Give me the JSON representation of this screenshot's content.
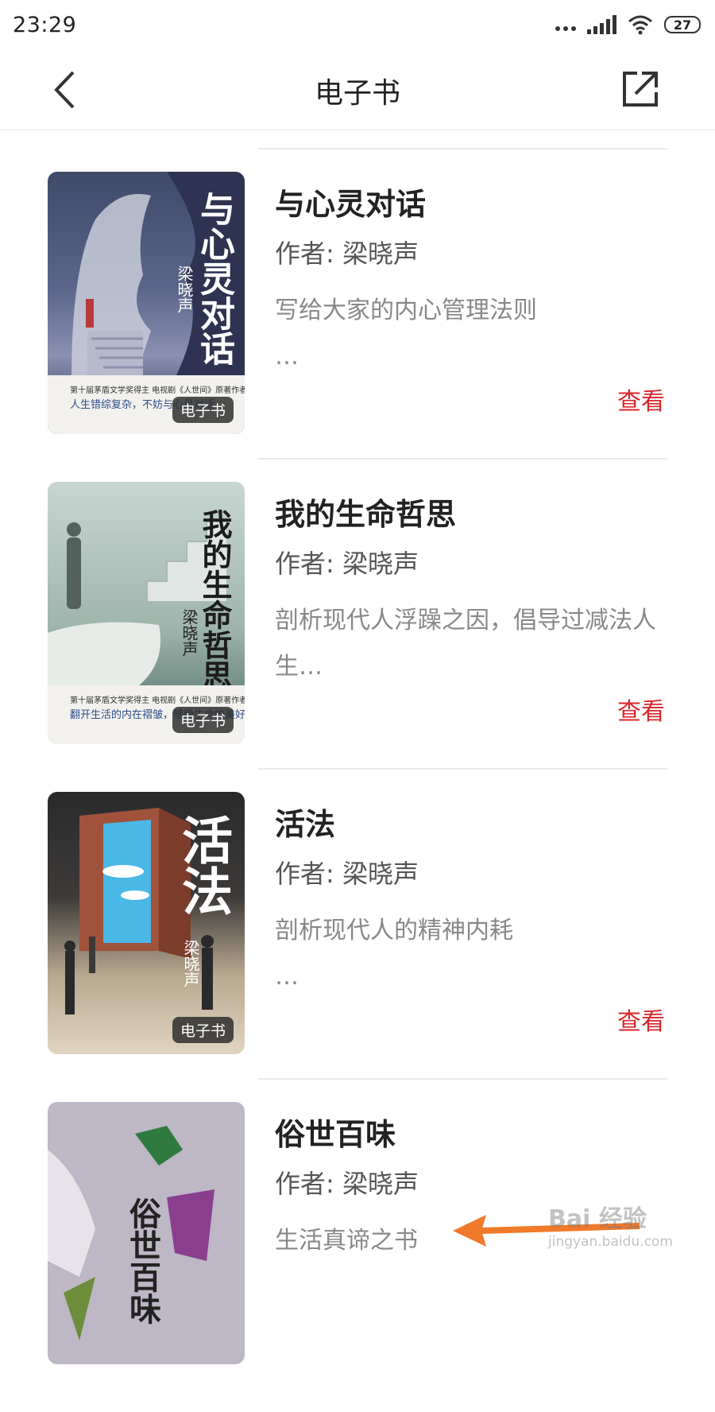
{
  "status_bar": {
    "time": "23:29",
    "battery": "27"
  },
  "header": {
    "title": "电子书"
  },
  "books": [
    {
      "title": "与心灵对话",
      "author": "作者: 梁晓声",
      "description": "写给大家的内心管理法则\n…",
      "action": "查看",
      "badge": "电子书",
      "cover_title": "与心灵对话",
      "cover_author": "梁晓声",
      "cover_line1": "第十届茅盾文学奖得主   电视剧《人世间》原著作者  梁晓声",
      "cover_line2": "人生错综复杂，不妨与心灵对话"
    },
    {
      "title": "我的生命哲思",
      "author": "作者: 梁晓声",
      "description": "剖析现代人浮躁之因，倡导过减法人生…",
      "action": "查看",
      "badge": "电子书",
      "cover_title": "我的生命哲思",
      "cover_author": "梁晓声",
      "cover_line1": "第十届茅盾文学奖得主   电视剧《人世间》原著作者  梁晓声",
      "cover_line2": "翻开生活的内在褶皱，感受生命的美好"
    },
    {
      "title": "活法",
      "author": "作者: 梁晓声",
      "description": "剖析现代人的精神内耗\n…",
      "action": "查看",
      "badge": "电子书",
      "cover_title": "活法",
      "cover_author": "梁晓声"
    },
    {
      "title": "俗世百味",
      "author": "作者: 梁晓声",
      "description": "生活真谛之书",
      "cover_title": "俗世百味"
    }
  ],
  "watermark": {
    "main": "Bai 经验",
    "sub": "jingyan.baidu.com"
  },
  "colors": {
    "accent": "#d8262a",
    "arrow": "#f07a2a"
  }
}
